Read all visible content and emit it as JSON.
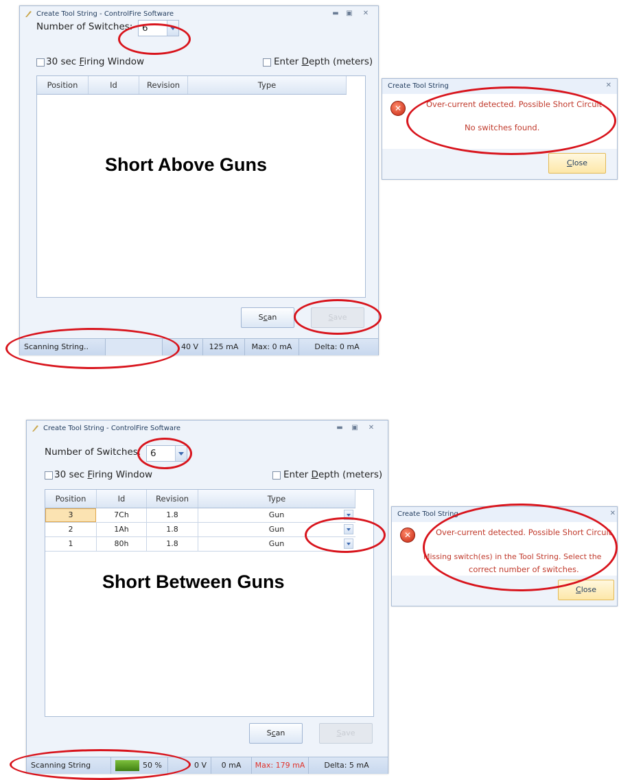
{
  "top": {
    "window_title": "Create Tool String - ControlFire Software",
    "num_switches_label": "Number of Switches:",
    "num_switches_value": "6",
    "firing_window_label": "30 sec Firing Window",
    "depth_label": "Enter Depth (meters)",
    "columns": [
      "Position",
      "Id",
      "Revision",
      "Type"
    ],
    "overlay_text": "Short Above Guns",
    "scan_label": "Scan",
    "save_label": "Save",
    "status": {
      "scanning": "Scanning String..",
      "progress": "",
      "voltage": "40 V",
      "current": "125 mA",
      "max": "Max: 0 mA",
      "delta": "Delta: 0 mA"
    }
  },
  "top_dialog": {
    "title": "Create Tool String",
    "message1": "Over-current detected. Possible Short Circuit",
    "message2": "No switches found.",
    "close_label": "Close"
  },
  "bottom": {
    "window_title": "Create Tool String - ControlFire Software",
    "num_switches_label": "Number of Switches:",
    "num_switches_value": "6",
    "firing_window_label": "30 sec Firing Window",
    "depth_label": "Enter Depth (meters)",
    "columns": [
      "Position",
      "Id",
      "Revision",
      "Type"
    ],
    "rows": [
      {
        "position": "3",
        "id": "7Ch",
        "revision": "1.8",
        "type": "Gun"
      },
      {
        "position": "2",
        "id": "1Ah",
        "revision": "1.8",
        "type": "Gun"
      },
      {
        "position": "1",
        "id": "80h",
        "revision": "1.8",
        "type": "Gun"
      }
    ],
    "overlay_text": "Short Between Guns",
    "scan_label": "Scan",
    "save_label": "Save",
    "status": {
      "scanning": "Scanning String",
      "progress_text": "50 %",
      "progress_value": 0.5,
      "voltage": "0 V",
      "current": "0 mA",
      "max": "Max: 179 mA",
      "delta": "Delta: 5 mA"
    }
  },
  "bottom_dialog": {
    "title": "Create Tool String",
    "message1": "Over-current detected. Possible Short Circuit",
    "message2": "Missing switch(es) in the Tool String. Select the",
    "message3": "correct number of switches.",
    "close_label": "Close"
  },
  "colors": {
    "annotation": "#d8141c",
    "error_text": "#c0392b",
    "max_text": "#e0322a",
    "progress": "#4f9a1c"
  }
}
